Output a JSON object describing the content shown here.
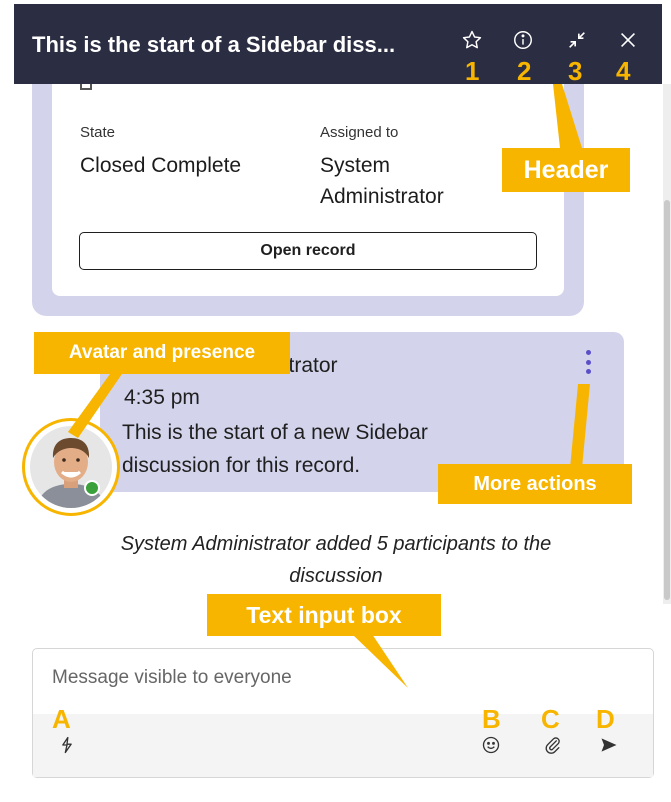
{
  "header": {
    "title": "This is the start of a Sidebar diss...",
    "bg_color": "#2b2d42",
    "buttons": [
      {
        "icon": "star-icon",
        "marker": "1"
      },
      {
        "icon": "info-icon",
        "marker": "2"
      },
      {
        "icon": "collapse-icon",
        "marker": "3"
      },
      {
        "icon": "close-icon",
        "marker": "4"
      }
    ]
  },
  "record": {
    "state_label": "State",
    "state_value": "Closed Complete",
    "assigned_label": "Assigned to",
    "assigned_value_line1": "System",
    "assigned_value_line2": "Administrator",
    "open_record_label": "Open record"
  },
  "message": {
    "sender_visible": "strator",
    "time": "4:35 pm",
    "text_line1": "This is the start of a new Sidebar",
    "text_line2": "discussion for this record.",
    "more_icon": "more-vertical-icon",
    "presence_status_color": "#3ba13b"
  },
  "system_message": {
    "line1": "System Administrator added 5 participants to the",
    "line2": "discussion"
  },
  "composer": {
    "placeholder": "Message visible to everyone",
    "buttons": [
      {
        "icon": "quick-actions-icon",
        "marker": "A"
      },
      {
        "icon": "emoji-icon",
        "marker": "B"
      },
      {
        "icon": "attachment-icon",
        "marker": "C"
      },
      {
        "icon": "send-icon",
        "marker": "D"
      }
    ]
  },
  "callouts": {
    "header": "Header",
    "avatar": "Avatar and presence",
    "more_actions": "More actions",
    "text_input": "Text input box",
    "color": "#f7b500"
  }
}
